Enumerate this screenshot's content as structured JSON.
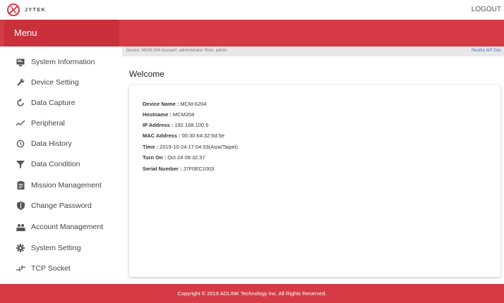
{
  "header": {
    "logo_text": "JYTEK",
    "logout_label": "LOGOUT"
  },
  "menu": {
    "title": "Menu",
    "items": [
      {
        "label": "System Information",
        "icon": "monitor-icon"
      },
      {
        "label": "Device Setting",
        "icon": "wrench-icon"
      },
      {
        "label": "Data Capture",
        "icon": "refresh-icon"
      },
      {
        "label": "Peripheral",
        "icon": "wave-icon"
      },
      {
        "label": "Data History",
        "icon": "history-icon"
      },
      {
        "label": "Data Condition",
        "icon": "filter-icon"
      },
      {
        "label": "Mission Management",
        "icon": "clipboard-icon"
      },
      {
        "label": "Change Password",
        "icon": "shield-icon"
      },
      {
        "label": "Account Management",
        "icon": "users-icon"
      },
      {
        "label": "System Setting",
        "icon": "gear-icon"
      },
      {
        "label": "TCP Socket",
        "icon": "socket-icon"
      }
    ]
  },
  "infobar": {
    "text": "Device: MCM-204   Account: administrator   Role: admin",
    "api_link": "Restful API Doc"
  },
  "main": {
    "welcome": "Welcome",
    "details": [
      {
        "label": "Device Name :",
        "value": " MCM-6204"
      },
      {
        "label": "Hostname :",
        "value": " MCM204"
      },
      {
        "label": "IP Address :",
        "value": " 192.168.100.5"
      },
      {
        "label": "MAC Address :",
        "value": " 00:30:64:32:5d:5e"
      },
      {
        "label": "Time :",
        "value": " 2019-10-24 17:04:53(Asia/Taipei)"
      },
      {
        "label": "Turn On :",
        "value": " Oct 24 09:32:37"
      },
      {
        "label": "Serial Number :",
        "value": " J7F0EC1003"
      }
    ]
  },
  "footer": {
    "copyright": "Copyright © 2019 ADLINK Technology Inc. All Rights Reserved."
  },
  "colors": {
    "brand_red": "#d63a44",
    "menu_header_red": "#c9303b",
    "link_blue": "#3b6bc9"
  }
}
